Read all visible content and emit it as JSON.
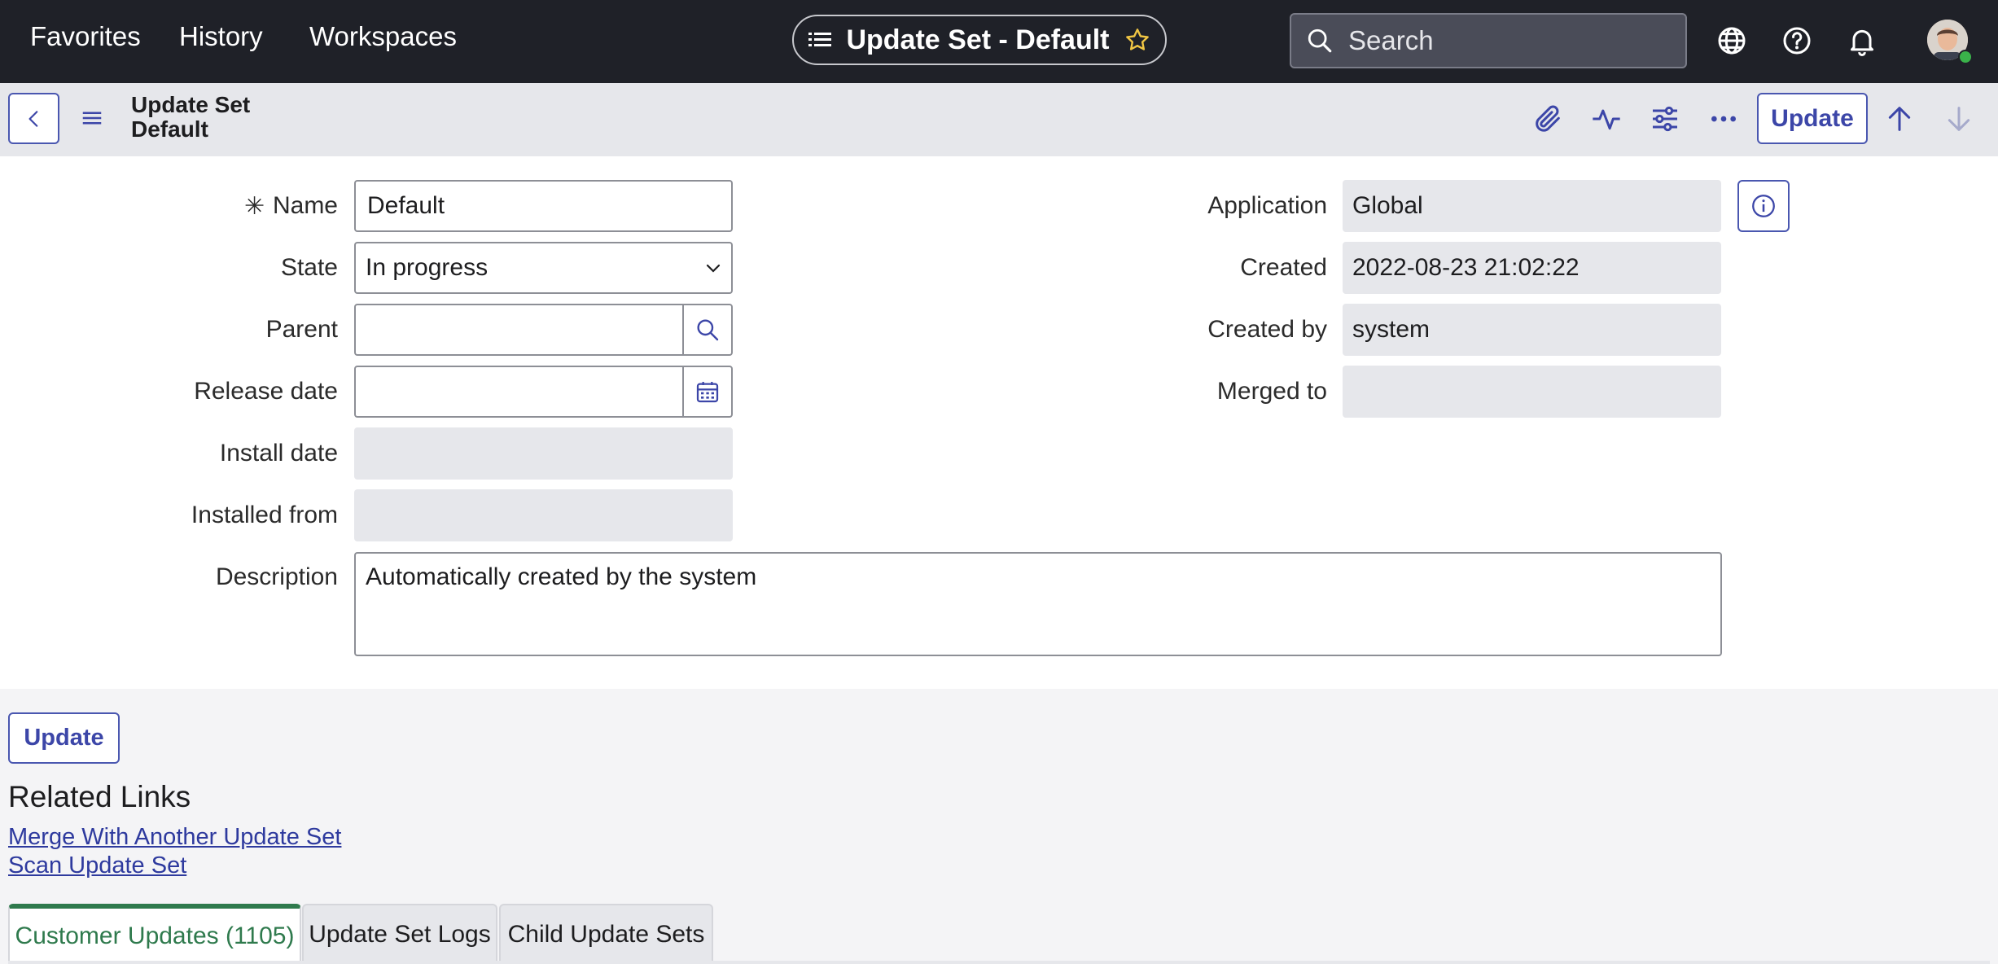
{
  "topnav": {
    "links": [
      "Favorites",
      "History",
      "Workspaces"
    ],
    "context_title": "Update Set - Default",
    "search_placeholder": "Search",
    "icons": [
      "globe-icon",
      "help-icon",
      "bell-icon"
    ]
  },
  "header": {
    "record_type": "Update Set",
    "record_name": "Default",
    "update_label": "Update",
    "icons": [
      "paperclip-icon",
      "activity-icon",
      "sliders-icon",
      "more-icon",
      "arrow-up-icon",
      "arrow-down-icon"
    ]
  },
  "form": {
    "name": {
      "label": "Name",
      "value": "Default",
      "required_mark": "✳"
    },
    "state": {
      "label": "State",
      "value": "In progress"
    },
    "parent": {
      "label": "Parent",
      "value": ""
    },
    "release_date": {
      "label": "Release date",
      "value": ""
    },
    "install_date": {
      "label": "Install date",
      "value": ""
    },
    "installed_from": {
      "label": "Installed from",
      "value": ""
    },
    "description": {
      "label": "Description",
      "value": "Automatically created by the system"
    },
    "application": {
      "label": "Application",
      "value": "Global"
    },
    "created": {
      "label": "Created",
      "value": "2022-08-23 21:02:22"
    },
    "created_by": {
      "label": "Created by",
      "value": "system"
    },
    "merged_to": {
      "label": "Merged to",
      "value": ""
    }
  },
  "footer": {
    "update_label": "Update",
    "related_title": "Related Links",
    "related_links": [
      "Merge With Another Update Set",
      "Scan Update Set"
    ]
  },
  "tabs": [
    {
      "label": "Customer Updates (1105)",
      "active": true
    },
    {
      "label": "Update Set Logs",
      "active": false
    },
    {
      "label": "Child Update Sets",
      "active": false
    }
  ],
  "colors": {
    "nav_bg": "#1f2128",
    "accent": "#3c46a8",
    "tab_active": "#2f7a4d"
  }
}
